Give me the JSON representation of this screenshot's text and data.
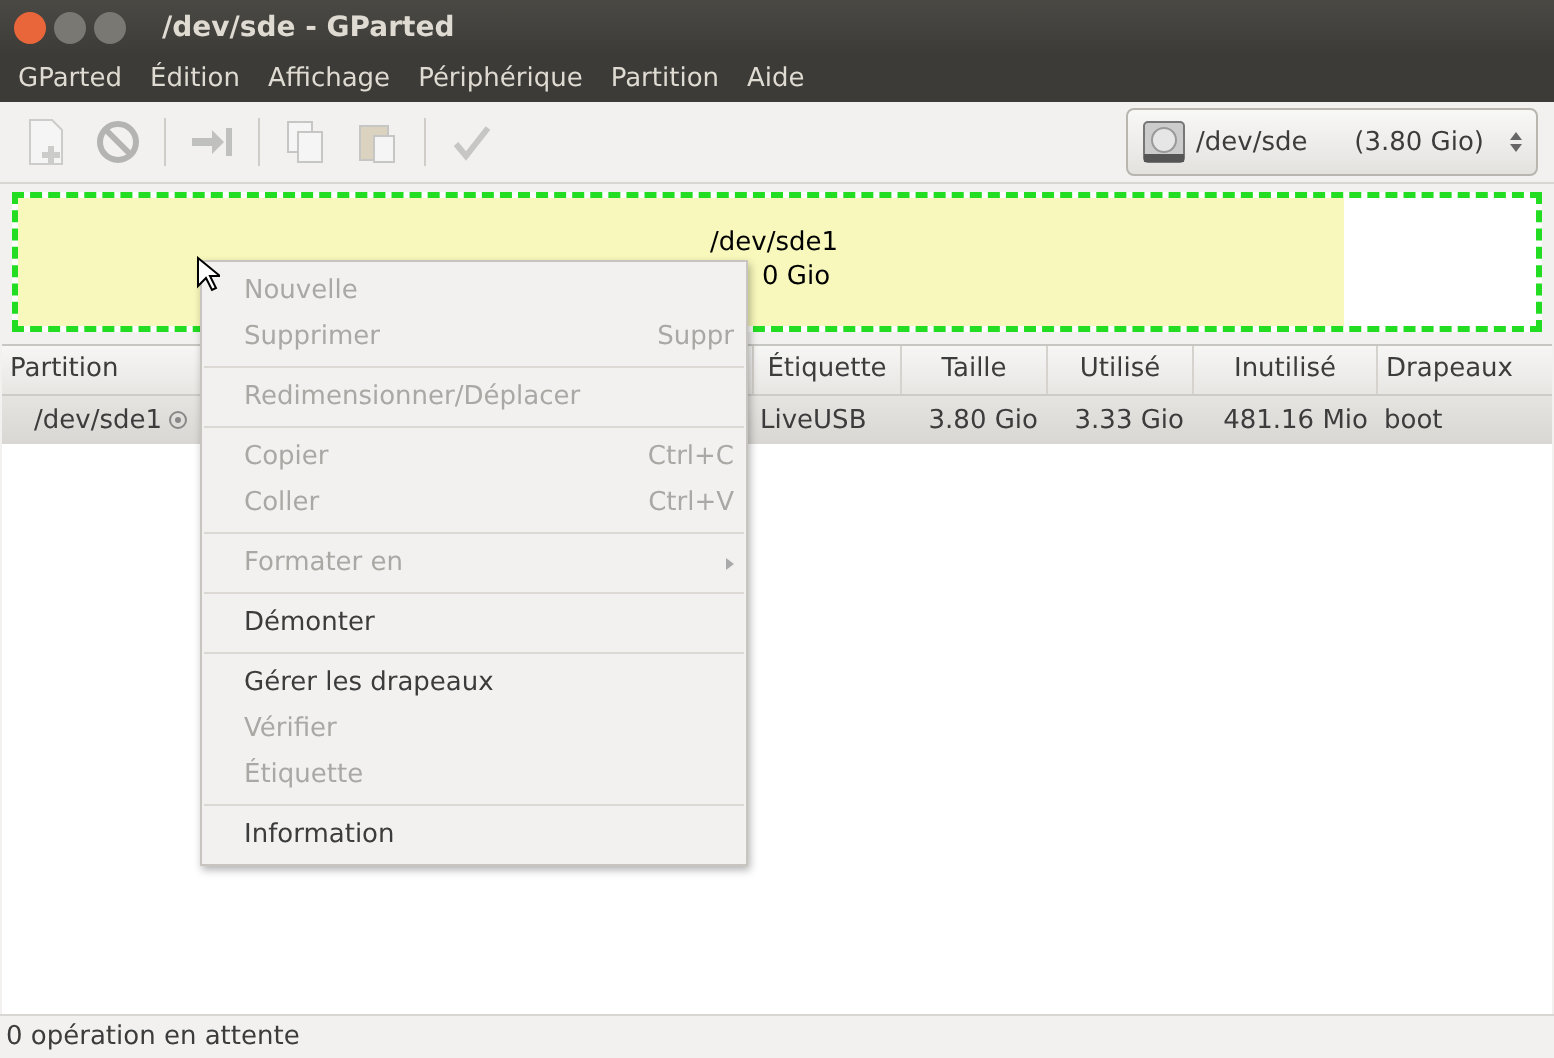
{
  "window": {
    "title": "/dev/sde - GParted"
  },
  "menubar": [
    "GParted",
    "Édition",
    "Affichage",
    "Périphérique",
    "Partition",
    "Aide"
  ],
  "toolbar": [
    {
      "kind": "new",
      "disabled": true
    },
    {
      "kind": "delete",
      "disabled": true
    },
    {
      "kind": "separator"
    },
    {
      "kind": "resize",
      "disabled": true
    },
    {
      "kind": "separator"
    },
    {
      "kind": "copy",
      "disabled": true
    },
    {
      "kind": "paste",
      "disabled": true
    },
    {
      "kind": "separator"
    },
    {
      "kind": "apply",
      "disabled": true
    }
  ],
  "device_selector": {
    "device": "/dev/sde",
    "size": "(3.80 Gio)"
  },
  "disk_map": {
    "selected": true,
    "level": 0.873,
    "name": "/dev/sde1",
    "size": "0 Gio"
  },
  "table": {
    "columns": [
      "Partition",
      "Étiquette",
      "Taille",
      "Utilisé",
      "Inutilisé",
      "Drapeaux"
    ],
    "rows": [
      {
        "selected": true,
        "mounted": true,
        "cells": [
          "/dev/sde1",
          "LiveUSB",
          "3.80 Gio",
          "3.33 Gio",
          "481.16 Mio",
          "boot"
        ]
      }
    ]
  },
  "context_menu": [
    {
      "kind": "item",
      "label": "Nouvelle",
      "disabled": true
    },
    {
      "kind": "item",
      "label": "Supprimer",
      "shortcut": "Suppr",
      "disabled": true
    },
    {
      "kind": "separator"
    },
    {
      "kind": "item",
      "label": "Redimensionner/Déplacer",
      "disabled": true
    },
    {
      "kind": "separator"
    },
    {
      "kind": "item",
      "label": "Copier",
      "shortcut": "Ctrl+C",
      "disabled": true
    },
    {
      "kind": "item",
      "label": "Coller",
      "shortcut": "Ctrl+V",
      "disabled": true
    },
    {
      "kind": "separator"
    },
    {
      "kind": "submenu",
      "label": "Formater en",
      "disabled": true
    },
    {
      "kind": "separator"
    },
    {
      "kind": "item",
      "label": "Démonter",
      "disabled": false
    },
    {
      "kind": "separator"
    },
    {
      "kind": "item",
      "label": "Gérer les drapeaux",
      "disabled": false
    },
    {
      "kind": "item",
      "label": "Vérifier",
      "disabled": true
    },
    {
      "kind": "item",
      "label": "Étiquette",
      "disabled": true
    },
    {
      "kind": "separator"
    },
    {
      "kind": "item",
      "label": "Information",
      "disabled": false
    }
  ],
  "status_bar": "0 opération en attente"
}
